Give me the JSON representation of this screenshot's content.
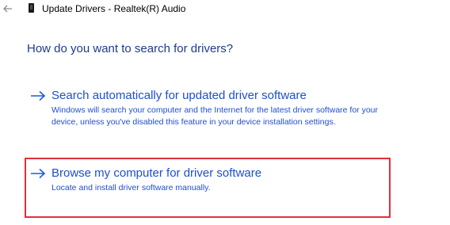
{
  "window": {
    "title": "Update Drivers - Realtek(R) Audio",
    "back_icon": "back-arrow-icon",
    "device_icon": "audio-device-icon"
  },
  "main": {
    "heading": "How do you want to search for drivers?",
    "options": [
      {
        "icon": "arrow-right-icon",
        "title": "Search automatically for updated driver software",
        "description": "Windows will search your computer and the Internet for the latest driver software for your device, unless you've disabled this feature in your device installation settings."
      },
      {
        "icon": "arrow-right-icon",
        "title": "Browse my computer for driver software",
        "description": "Locate and install driver software manually."
      }
    ]
  },
  "colors": {
    "link_blue": "#1c4fd0",
    "heading_blue": "#1f3b8f",
    "highlight_red": "#e0303a"
  }
}
